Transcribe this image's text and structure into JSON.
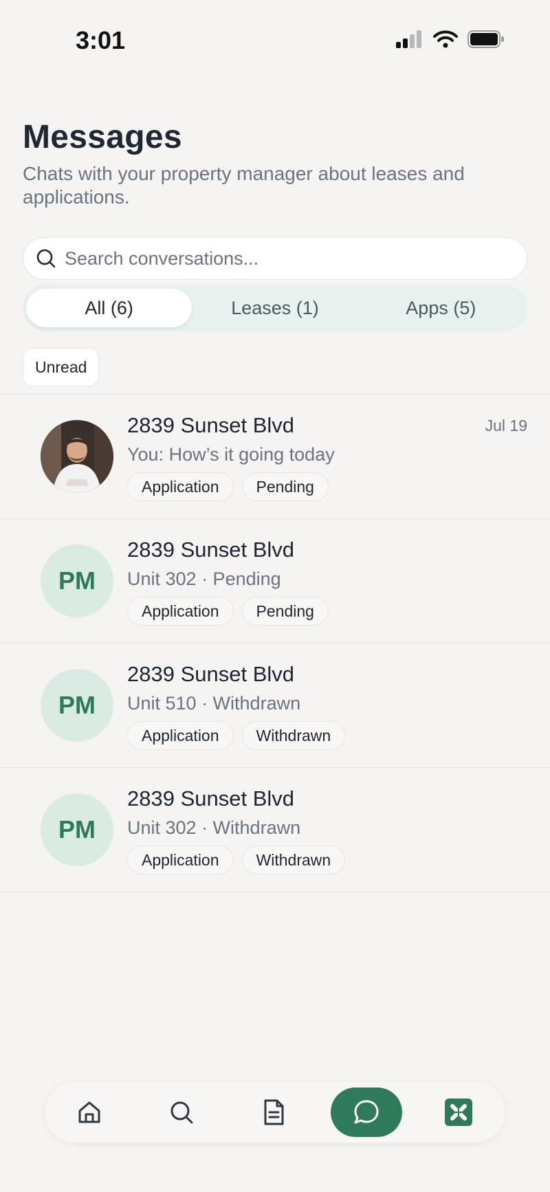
{
  "status_bar": {
    "time": "3:01"
  },
  "header": {
    "title": "Messages",
    "subtitle": "Chats with your property manager about leases and applications."
  },
  "search": {
    "placeholder": "Search conversations..."
  },
  "segments": [
    {
      "label": "All (6)",
      "active": true
    },
    {
      "label": "Leases (1)",
      "active": false
    },
    {
      "label": "Apps (5)",
      "active": false
    }
  ],
  "filter": {
    "unread_label": "Unread"
  },
  "conversations": [
    {
      "title": "2839 Sunset Blvd",
      "subtitle": "You: How’s it going today",
      "date": "Jul 19",
      "avatar": "photo",
      "tags": [
        "Application",
        "Pending"
      ]
    },
    {
      "title": "2839 Sunset Blvd",
      "subtitle": "Unit 302 · Pending",
      "date": "",
      "avatar": "PM",
      "tags": [
        "Application",
        "Pending"
      ]
    },
    {
      "title": "2839 Sunset Blvd",
      "subtitle": "Unit 510 · Withdrawn",
      "date": "",
      "avatar": "PM",
      "tags": [
        "Application",
        "Withdrawn"
      ]
    },
    {
      "title": "2839 Sunset Blvd",
      "subtitle": "Unit 302 · Withdrawn",
      "date": "",
      "avatar": "PM",
      "tags": [
        "Application",
        "Withdrawn"
      ]
    }
  ],
  "bottom_nav": [
    {
      "icon": "home-icon",
      "active": false
    },
    {
      "icon": "search-icon",
      "active": false
    },
    {
      "icon": "document-icon",
      "active": false
    },
    {
      "icon": "chat-icon",
      "active": true
    },
    {
      "icon": "app-logo-icon",
      "active": false
    }
  ],
  "colors": {
    "accent": "#2e7a5a",
    "avatar_bg": "#d9ebe3",
    "segment_bg": "#e7f1ed",
    "background": "#f5f4f2"
  }
}
